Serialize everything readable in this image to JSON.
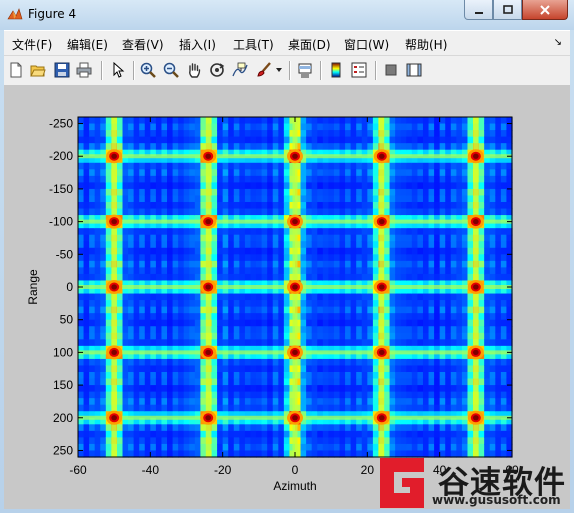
{
  "window": {
    "title": "Figure 4"
  },
  "menu": {
    "items": [
      {
        "label": "文件(F)"
      },
      {
        "label": "编辑(E)"
      },
      {
        "label": "查看(V)"
      },
      {
        "label": "插入(I)"
      },
      {
        "label": "工具(T)"
      },
      {
        "label": "桌面(D)"
      },
      {
        "label": "窗口(W)"
      },
      {
        "label": "帮助(H)"
      }
    ]
  },
  "toolbar": {
    "icons": [
      "new-figure-icon",
      "open-file-icon",
      "save-icon",
      "print-icon",
      "select-arrow-icon",
      "zoom-in-icon",
      "zoom-out-icon",
      "pan-hand-icon",
      "rotate-3d-icon",
      "data-cursor-icon",
      "brush-icon",
      "dropdown-icon",
      "link-plot-icon",
      "colorbar-icon",
      "legend-icon",
      "hide-plot-tools-icon",
      "show-plot-tools-icon"
    ]
  },
  "chart_data": {
    "type": "heatmap",
    "title": "",
    "xlabel": "Azimuth",
    "ylabel": "Range",
    "xlim": [
      -60,
      60
    ],
    "ylim": [
      -260,
      260
    ],
    "y_direction": "reverse",
    "xticks": [
      -60,
      -40,
      -20,
      0,
      20,
      40,
      60
    ],
    "yticks": [
      -250,
      -200,
      -150,
      -100,
      -50,
      0,
      50,
      100,
      150,
      200,
      250
    ],
    "colormap": "jet",
    "peak_azimuths": [
      -50,
      -24,
      0,
      24,
      50
    ],
    "peak_ranges": [
      -200,
      -100,
      0,
      100,
      200
    ],
    "grid": false
  },
  "watermark": {
    "text": "谷速软件",
    "url": "www.gususoft.com"
  }
}
